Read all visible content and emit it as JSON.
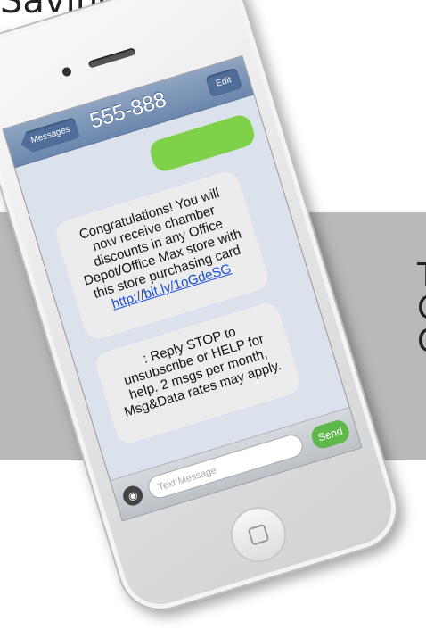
{
  "page": {
    "top_text": "Savings!",
    "band_letters": [
      "T",
      "C",
      "C"
    ]
  },
  "phone": {
    "nav": {
      "back_label": "Messages",
      "title": "555-888",
      "edit_label": "Edit"
    },
    "messages": [
      {
        "direction": "outgoing",
        "text": "",
        "color": "#7ed24a"
      },
      {
        "direction": "incoming",
        "text": "Congratulations! You will now receive chamber discounts in any Office Depot/Office Max store with this store purchasing card",
        "link": "http://bit.ly/1oGdeSG"
      },
      {
        "direction": "incoming",
        "text": ": Reply STOP to unsubscribe or HELP for help. 2 msgs per month, Msg&Data rates may apply."
      }
    ],
    "input": {
      "placeholder": "Text Message",
      "send_label": "Send"
    }
  },
  "colors": {
    "band": "#b9b9b9",
    "nav_bar": "#6c87ad",
    "send": "#5fb84a"
  }
}
